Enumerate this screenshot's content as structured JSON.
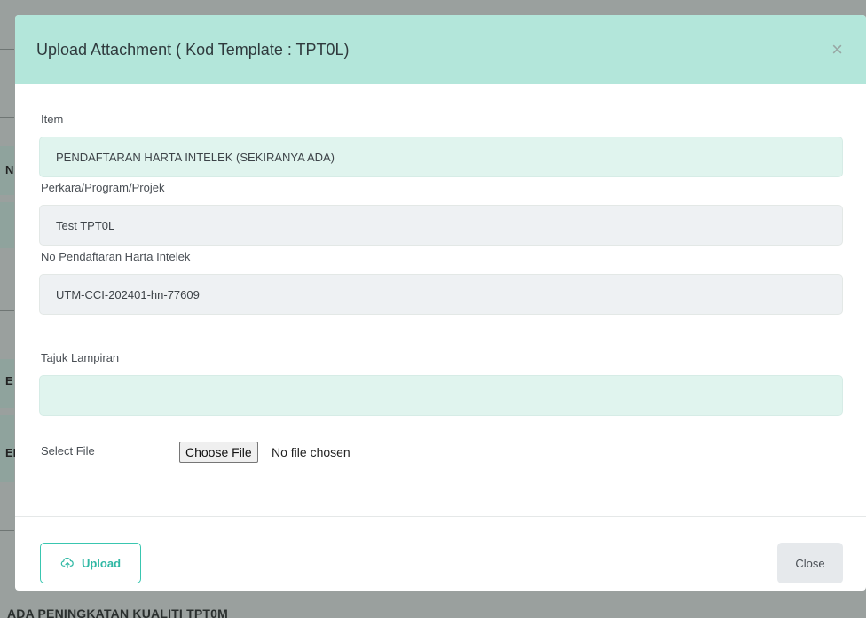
{
  "background": {
    "side_letters": [
      "N",
      "E",
      "EI"
    ],
    "footer_text": "ADA PENINGKATAN KUALITI TPT0M"
  },
  "modal": {
    "title": "Upload Attachment ( Kod Template : TPT0L)",
    "close_symbol": "×",
    "fields": {
      "item": {
        "label": "Item",
        "value": "PENDAFTARAN HARTA INTELEK (SEKIRANYA ADA)"
      },
      "perkara": {
        "label": "Perkara/Program/Projek",
        "value": "Test TPT0L"
      },
      "no_pendaftaran": {
        "label": "No Pendaftaran Harta Intelek",
        "value": "UTM-CCI-202401-hn-77609"
      },
      "tajuk": {
        "label": "Tajuk Lampiran",
        "value": ""
      }
    },
    "file": {
      "label": "Select File",
      "button_label": "Choose File",
      "status": "No file chosen"
    },
    "buttons": {
      "upload": "Upload",
      "close": "Close"
    },
    "colors": {
      "header_bg": "#b3e6da",
      "accent": "#39c6b0",
      "mint_field": "#e0f4ee",
      "grey_field": "#eef1f3"
    }
  }
}
